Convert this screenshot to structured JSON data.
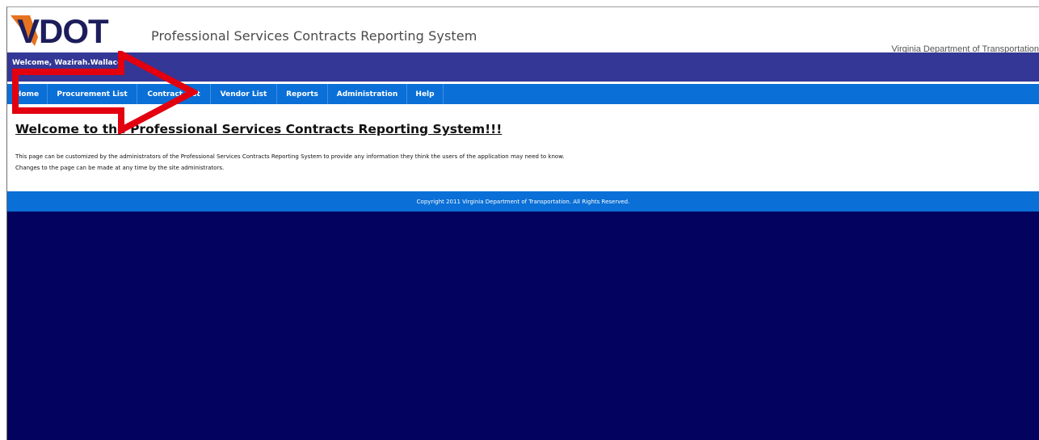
{
  "header": {
    "logo_text": "VDOT",
    "app_title": "Professional Services Contracts Reporting System",
    "agency": "Virginia Department of Transportation"
  },
  "welcome": {
    "text": "Welcome, Wazirah.Wallace"
  },
  "nav": {
    "items": [
      {
        "label": "Home"
      },
      {
        "label": "Procurement List"
      },
      {
        "label": "Contract List"
      },
      {
        "label": "Vendor List"
      },
      {
        "label": "Reports"
      },
      {
        "label": "Administration"
      },
      {
        "label": "Help"
      }
    ]
  },
  "content": {
    "heading": "Welcome to the Professional Services Contracts Reporting System!!!",
    "line1": "This page can be customized by the administrators of the Professional Services Contracts Reporting System to provide any information they think the users of the application may need to know.",
    "line2": "Changes to the page can be made at any time by the site administrators."
  },
  "footer": {
    "copyright": "Copyright 2011 Virginia Department of Transportation. All Rights Reserved."
  },
  "annotation": {
    "arrow_color": "#e3000f"
  },
  "colors": {
    "welcome_bar": "#343795",
    "nav_bar": "#0a6fd6",
    "background": "#03025e",
    "logo_orange": "#e6731e",
    "logo_navy": "#1d1d5c"
  }
}
